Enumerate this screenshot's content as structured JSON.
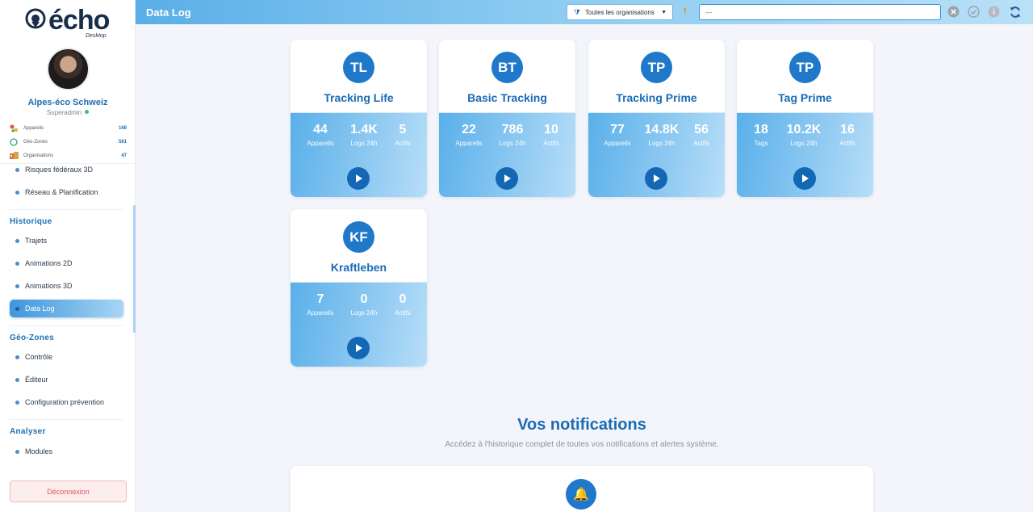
{
  "app": {
    "logo_text": "écho",
    "logo_sub": "Desktop"
  },
  "profile": {
    "org_name": "Alpes-éco Schweiz",
    "role": "Superadmin"
  },
  "stats": [
    {
      "label": "Appareils",
      "value": "168",
      "icon": "devices-icon"
    },
    {
      "label": "Géo-Zones",
      "value": "561",
      "icon": "geozone-icon"
    },
    {
      "label": "Organisations",
      "value": "47",
      "icon": "organisations-icon"
    }
  ],
  "nav": {
    "pre_items": [
      "Risques fédéraux 3D",
      "Réseau & Planification"
    ],
    "historique": {
      "title": "Historique",
      "items": [
        "Trajets",
        "Animations 2D",
        "Animations 3D",
        "Data Log"
      ]
    },
    "geozones": {
      "title": "Géo-Zones",
      "items": [
        "Contrôle",
        "Éditeur",
        "Configuration prévention"
      ]
    },
    "analyser": {
      "title": "Analyser",
      "items": [
        "Modules"
      ]
    },
    "active": "Data Log"
  },
  "logout_label": "Déconnexion",
  "header": {
    "title": "Data Log",
    "org_select": "Toutes les organisations",
    "warn": "!",
    "search_value": "—"
  },
  "colors": {
    "accent": "#1f78c9",
    "brand": "#1a6bb5",
    "danger": "#e05454"
  },
  "cards": [
    {
      "initials": "TL",
      "title": "Tracking Life",
      "metrics": [
        {
          "v": "44",
          "l": "Appareils"
        },
        {
          "v": "1.4K",
          "l": "Logs 24h"
        },
        {
          "v": "5",
          "l": "Actifs"
        }
      ]
    },
    {
      "initials": "BT",
      "title": "Basic Tracking",
      "metrics": [
        {
          "v": "22",
          "l": "Appareils"
        },
        {
          "v": "786",
          "l": "Logs 24h"
        },
        {
          "v": "10",
          "l": "Actifs"
        }
      ]
    },
    {
      "initials": "TP",
      "title": "Tracking Prime",
      "metrics": [
        {
          "v": "77",
          "l": "Appareils"
        },
        {
          "v": "14.8K",
          "l": "Logs 24h"
        },
        {
          "v": "56",
          "l": "Actifs"
        }
      ]
    },
    {
      "initials": "TP",
      "title": "Tag Prime",
      "metrics": [
        {
          "v": "18",
          "l": "Tags"
        },
        {
          "v": "10.2K",
          "l": "Logs 24h"
        },
        {
          "v": "16",
          "l": "Actifs"
        }
      ]
    },
    {
      "initials": "KF",
      "title": "Kraftleben",
      "metrics": [
        {
          "v": "7",
          "l": "Appareils"
        },
        {
          "v": "0",
          "l": "Logs 24h"
        },
        {
          "v": "0",
          "l": "Actifs"
        }
      ]
    }
  ],
  "notifications": {
    "title": "Vos notifications",
    "subtitle": "Accédez à l'historique complet de toutes vos notifications et alertes système."
  }
}
